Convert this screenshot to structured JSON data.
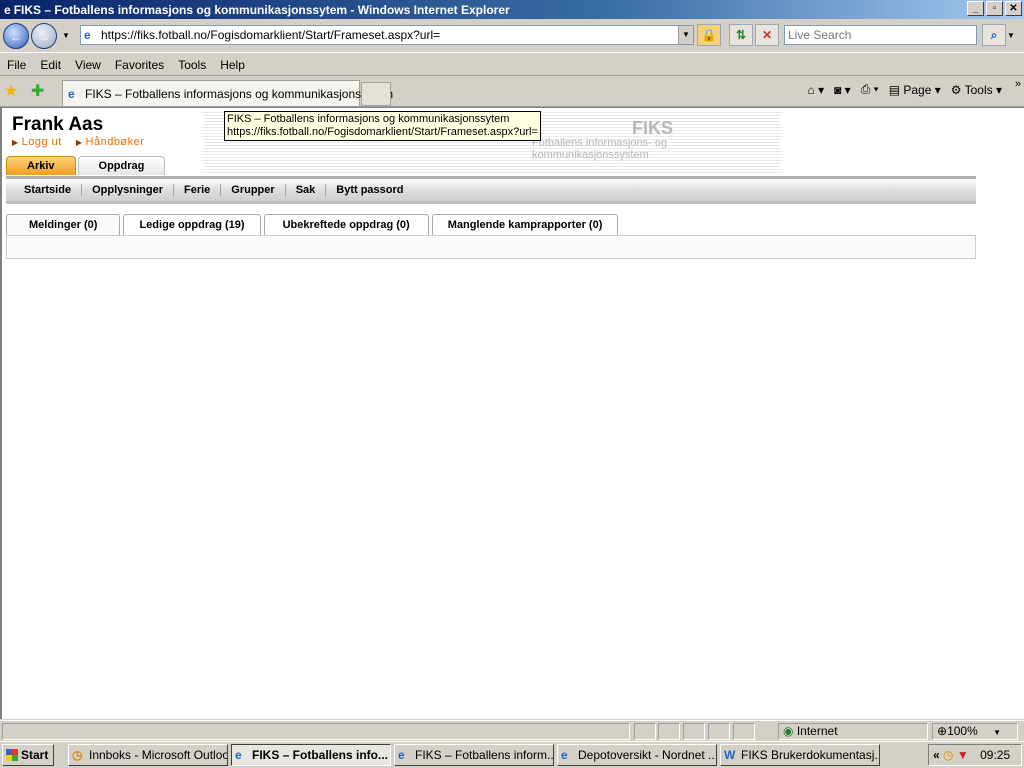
{
  "window": {
    "title": "FIKS – Fotballens informasjons og kommunikasjonssytem - Windows Internet Explorer",
    "minimize": "_",
    "maximize": "▫",
    "close": "✕"
  },
  "address": {
    "url": "https://fiks.fotball.no/Fogisdomarklient/Start/Frameset.aspx?url=",
    "search_placeholder": "Live Search"
  },
  "menu": [
    "File",
    "Edit",
    "View",
    "Favorites",
    "Tools",
    "Help"
  ],
  "browser_tab": {
    "label": "FIKS – Fotballens informasjons og kommunikasjonssytem"
  },
  "command_bar": {
    "page": "Page",
    "tools": "Tools"
  },
  "tooltip": {
    "line1": "FIKS – Fotballens informasjons og kommunikasjonssytem",
    "line2": "https://fiks.fotball.no/Fogisdomarklient/Start/Frameset.aspx?url="
  },
  "page": {
    "user_name": "Frank Aas",
    "links": [
      "Logg ut",
      "Håndbøker"
    ],
    "banner_title": "FIKS",
    "banner_subtitle": "Fotballens informasjons- og kommunikasjonssystem",
    "main_tabs": [
      {
        "label": "Arkiv",
        "active": true
      },
      {
        "label": "Oppdrag",
        "active": false
      }
    ],
    "subnav": [
      "Startside",
      "Opplysninger",
      "Ferie",
      "Grupper",
      "Sak",
      "Bytt passord"
    ],
    "content_tabs": [
      {
        "label": "Meldinger (0)",
        "active": true
      },
      {
        "label": "Ledige oppdrag (19)"
      },
      {
        "label": "Ubekreftede oppdrag (0)"
      },
      {
        "label": "Manglende kamprapporter (0)"
      }
    ],
    "accent_color": "#f0a020"
  },
  "status": {
    "zone": "Internet",
    "zoom": "100%"
  },
  "taskbar": {
    "start": "Start",
    "items": [
      {
        "label": "Innboks - Microsoft Outlook",
        "icon": "outlook-icon"
      },
      {
        "label": "FIKS – Fotballens info...",
        "icon": "ie-icon",
        "active": true
      },
      {
        "label": "FIKS – Fotballens inform...",
        "icon": "ie-icon"
      },
      {
        "label": "Depotoversikt - Nordnet ...",
        "icon": "ie-icon"
      },
      {
        "label": "FIKS Brukerdokumentasj...",
        "icon": "word-icon"
      }
    ],
    "clock": "09:25"
  }
}
